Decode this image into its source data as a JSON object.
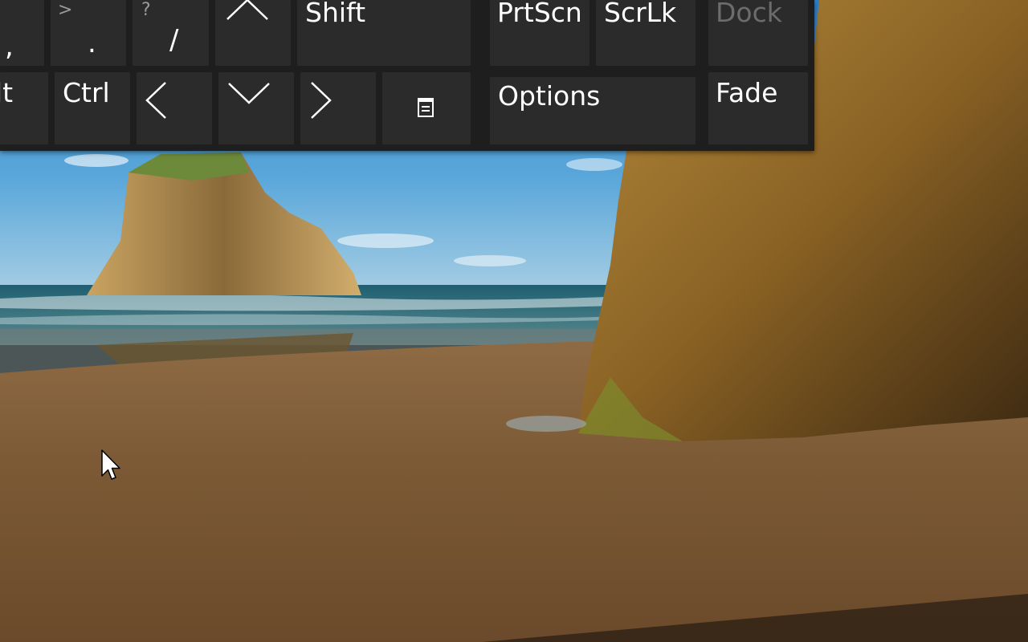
{
  "keyboard": {
    "row1": {
      "comma": {
        "main": ","
      },
      "period": {
        "shift": ">",
        "main": "."
      },
      "slash": {
        "shift": "?",
        "main": "/"
      },
      "up_arrow_icon": "caret-up-icon",
      "shift": "Shift",
      "prtscn": "PrtScn",
      "scrlk": "ScrLk",
      "dock": "Dock"
    },
    "row2": {
      "alt": "lt",
      "ctrl": "Ctrl",
      "left_arrow_icon": "chevron-left-icon",
      "down_arrow_icon": "chevron-down-icon",
      "right_arrow_icon": "chevron-right-icon",
      "menu_icon": "context-menu-icon",
      "options": "Options",
      "fade": "Fade"
    },
    "colors": {
      "background": "#1e1e1e",
      "key": "#2b2b2b",
      "text": "#ffffff",
      "disabled_text": "#6c6c6c"
    }
  },
  "desktop": {
    "wallpaper": "beach-rock-wallpaper",
    "cursor_icon": "arrow-pointer-icon"
  }
}
